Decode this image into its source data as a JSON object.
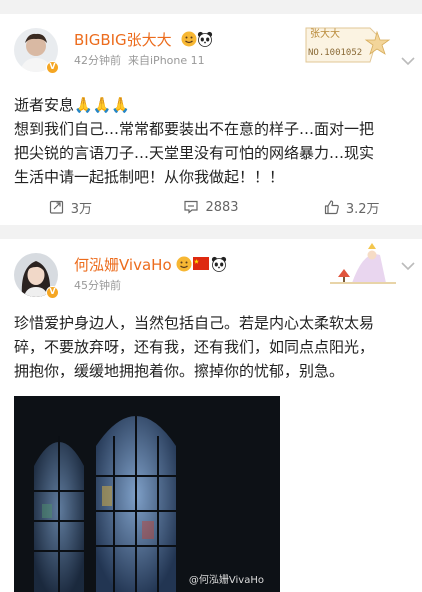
{
  "post1": {
    "author": "BIGBIG张大大",
    "time": "42分钟前",
    "source": "来自iPhone 11",
    "badge_name": "张大大",
    "badge_no": "NO.1001052",
    "lines": [
      "逝者安息🙏🙏🙏",
      "想到我们自己…常常都要装出不在意的样子…面对一把",
      "把尖锐的言语刀子…天堂里没有可怕的网络暴力…现实",
      "生活中请一起抵制吧！从你我做起！！！"
    ],
    "reposts": "3万",
    "comments": "2883",
    "likes": "3.2万"
  },
  "post2": {
    "author": "何泓姗VivaHo",
    "time": "45分钟前",
    "lines": [
      "珍惜爱护身边人，当然包括自己。若是内心太柔软太易",
      "碎，不要放弃呀，还有我，还有我们，如同点点阳光，",
      "拥抱你，缓缓地拥抱着你。擦掉你的忧郁，别急。"
    ],
    "watermark": "@何泓姗VivaHo"
  },
  "colors": {
    "name": "#ec6c1d",
    "meta": "#999999",
    "divider": "#f2f2f2",
    "verified": "#f5a623"
  },
  "icons": [
    "repost-icon",
    "comment-icon",
    "like-icon",
    "chevron-down-icon",
    "verified-icon",
    "panda-icon",
    "flag-icon",
    "emoji-icon"
  ]
}
